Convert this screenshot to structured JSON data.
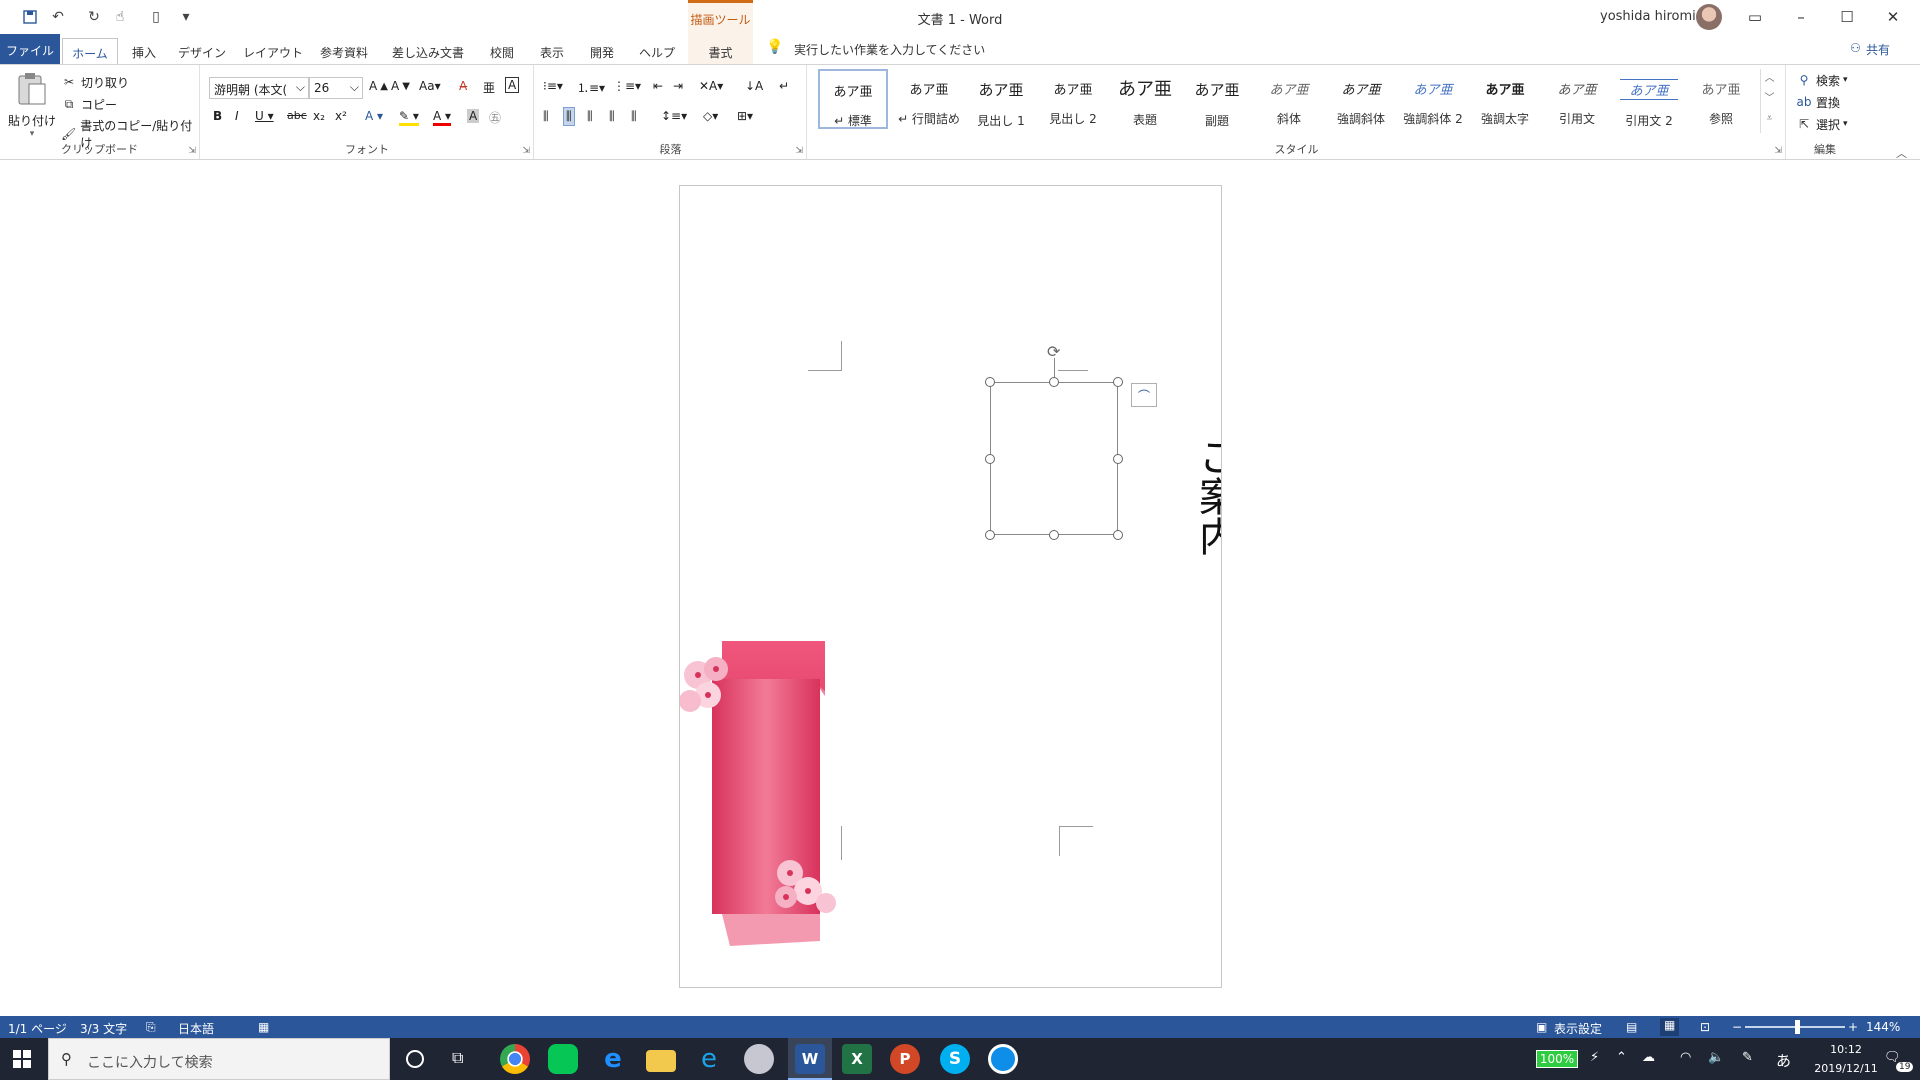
{
  "window": {
    "doc_title": "文書 1  -  Word",
    "user_name": "yoshida hiromi",
    "context_tab_group": "描画ツール"
  },
  "tabs": [
    "ファイル",
    "ホーム",
    "挿入",
    "デザイン",
    "レイアウト",
    "参考資料",
    "差し込み文書",
    "校閲",
    "表示",
    "開発",
    "ヘルプ",
    "書式"
  ],
  "tell_me": "実行したい作業を入力してください",
  "share": "共有",
  "clipboard": {
    "label": "クリップボード",
    "paste": "貼り付け",
    "cut": "切り取り",
    "copy": "コピー",
    "format_painter": "書式のコピー/貼り付け"
  },
  "font": {
    "label": "フォント",
    "name": "游明朝 (本文(",
    "size": "26"
  },
  "paragraph": {
    "label": "段落"
  },
  "styles": {
    "label": "スタイル",
    "items": [
      {
        "preview": "あア亜",
        "name": "↵ 標準"
      },
      {
        "preview": "あア亜",
        "name": "↵ 行間詰め"
      },
      {
        "preview": "あア亜",
        "name": "見出し 1"
      },
      {
        "preview": "あア亜",
        "name": "見出し 2"
      },
      {
        "preview": "あア亜",
        "name": "表題"
      },
      {
        "preview": "あア亜",
        "name": "副題"
      },
      {
        "preview": "あア亜",
        "name": "斜体"
      },
      {
        "preview": "あア亜",
        "name": "強調斜体"
      },
      {
        "preview": "あア亜",
        "name": "強調斜体 2"
      },
      {
        "preview": "あア亜",
        "name": "強調太字"
      },
      {
        "preview": "あア亜",
        "name": "引用文"
      },
      {
        "preview": "あア亜",
        "name": "引用文 2"
      },
      {
        "preview": "あア亜",
        "name": "参照"
      }
    ]
  },
  "editing": {
    "label": "編集",
    "find": "検索",
    "replace": "置換",
    "select": "選択"
  },
  "document": {
    "vertical_text": "ご案内"
  },
  "status": {
    "page": "1/1 ページ",
    "words": "3/3 文字",
    "language": "日本語",
    "display_settings": "表示設定",
    "zoom": "144%"
  },
  "taskbar": {
    "search_placeholder": "ここに入力して検索",
    "battery": "100%",
    "ime": "あ",
    "time": "10:12",
    "date": "2019/12/11",
    "notifications": "19"
  },
  "colors": {
    "accent": "#2b579a",
    "context": "#d06c16",
    "ribbon_pink": "#e8456f"
  }
}
